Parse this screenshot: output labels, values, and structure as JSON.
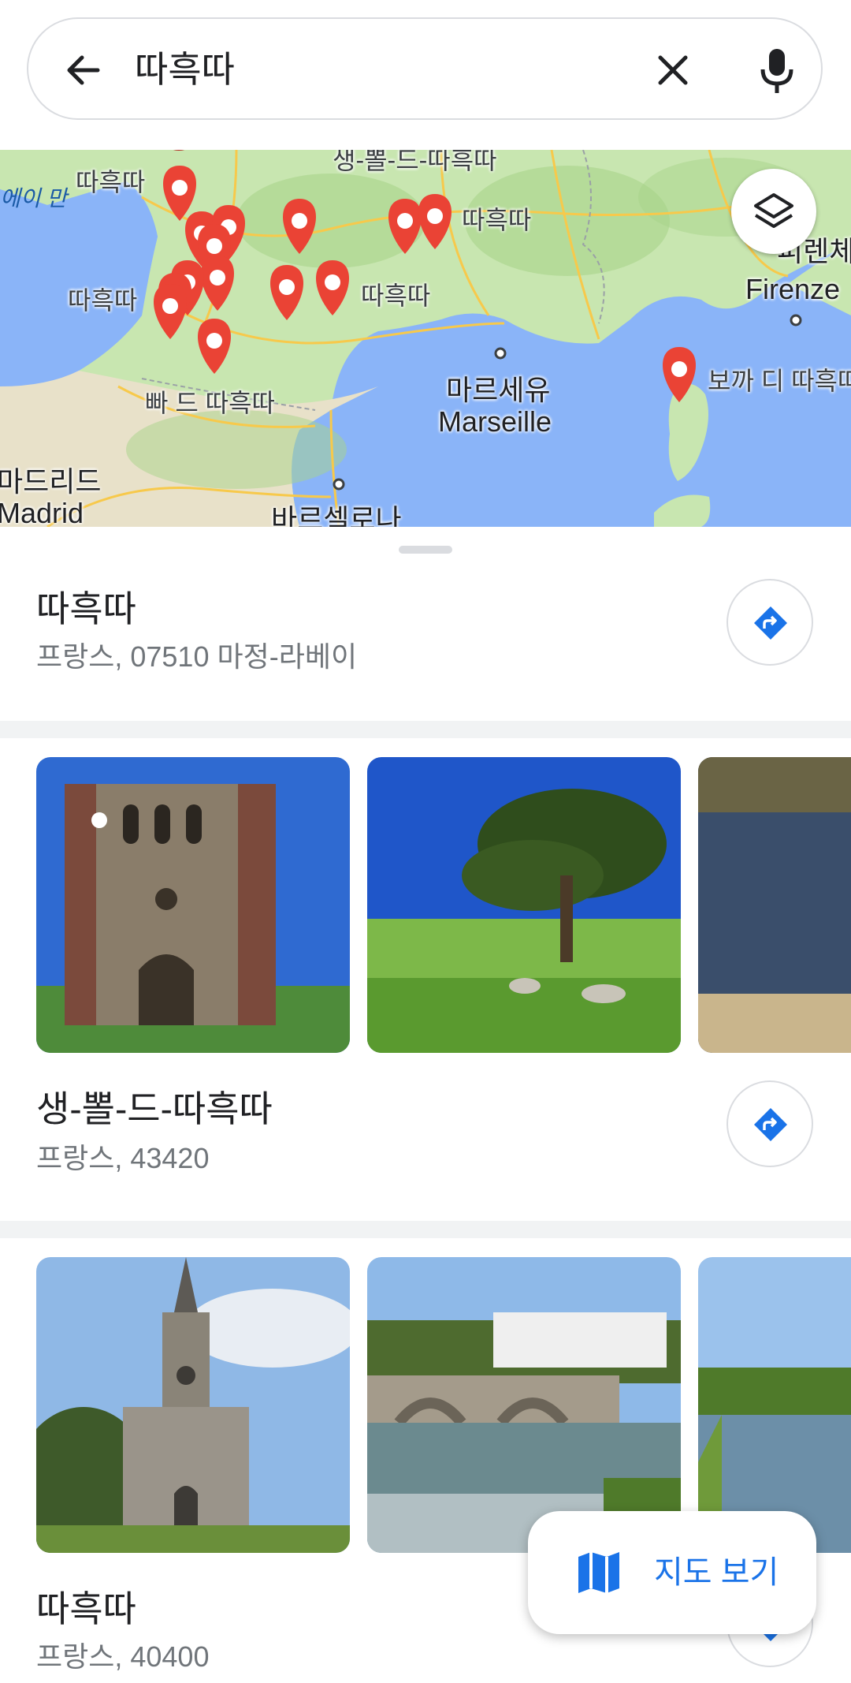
{
  "search": {
    "query": "따흑따"
  },
  "icons": {
    "back": "arrow-left-icon",
    "clear": "close-icon",
    "mic": "microphone-icon",
    "layers": "layers-icon",
    "directions": "directions-icon",
    "map": "map-icon"
  },
  "map": {
    "labels": {
      "bay": "에이 만",
      "t1": "따흑따",
      "t2": "따흑따",
      "t3": "따흑따",
      "t4": "따흑따",
      "top": "생-뽈-드-따흑따",
      "south": "빠 드 따흑따",
      "marseille_kr": "마르세유",
      "marseille_en": "Marseille",
      "madrid_kr": "마드리드",
      "madrid_en": "Madrid",
      "barcelona": "바르셀로나",
      "firenze_kr": "피렌체",
      "firenze_en": "Firenze",
      "corsica": "보까 디 따흑따"
    }
  },
  "results": [
    {
      "name": "따흑따",
      "address": "프랑스, 07510 마정-라베이"
    },
    {
      "name": "생-뽈-드-따흑따",
      "address": "프랑스, 43420"
    },
    {
      "name": "따흑따",
      "address": "프랑스, 40400"
    }
  ],
  "fab": {
    "label": "지도 보기"
  },
  "colors": {
    "accent": "#1a73e8",
    "pin": "#ea4335",
    "land": "#c8e6b0",
    "sea": "#8ab4f8"
  }
}
